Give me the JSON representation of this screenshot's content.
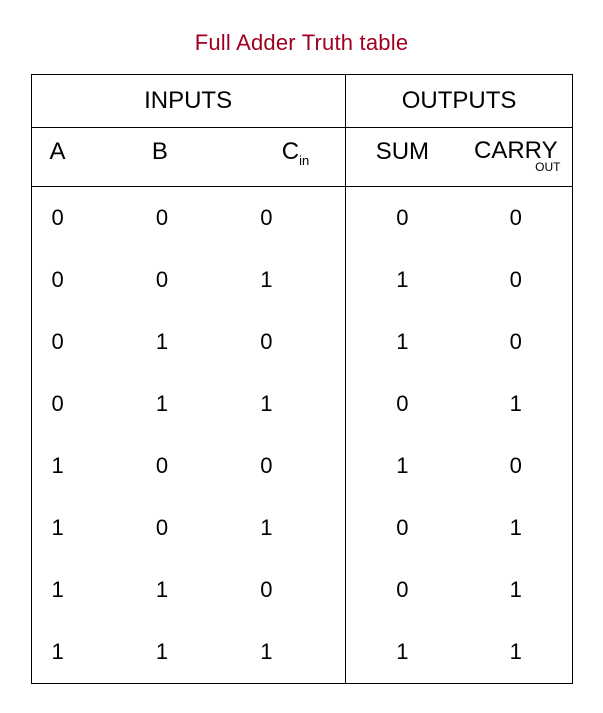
{
  "title": "Full Adder Truth table",
  "group_headers": {
    "inputs": "INPUTS",
    "outputs": "OUTPUTS"
  },
  "columns": {
    "a": "A",
    "b": "B",
    "cin": "C",
    "cin_sub": "in",
    "sum": "SUM",
    "carry": "CARRY",
    "carry_sub": "OUT"
  },
  "rows": [
    {
      "a": "0",
      "b": "0",
      "cin": "0",
      "sum": "0",
      "carry": "0"
    },
    {
      "a": "0",
      "b": "0",
      "cin": "1",
      "sum": "1",
      "carry": "0"
    },
    {
      "a": "0",
      "b": "1",
      "cin": "0",
      "sum": "1",
      "carry": "0"
    },
    {
      "a": "0",
      "b": "1",
      "cin": "1",
      "sum": "0",
      "carry": "1"
    },
    {
      "a": "1",
      "b": "0",
      "cin": "0",
      "sum": "1",
      "carry": "0"
    },
    {
      "a": "1",
      "b": "0",
      "cin": "1",
      "sum": "0",
      "carry": "1"
    },
    {
      "a": "1",
      "b": "1",
      "cin": "0",
      "sum": "0",
      "carry": "1"
    },
    {
      "a": "1",
      "b": "1",
      "cin": "1",
      "sum": "1",
      "carry": "1"
    }
  ],
  "chart_data": {
    "type": "table",
    "title": "Full Adder Truth table",
    "columns": [
      "A",
      "B",
      "Cin",
      "SUM",
      "CARRY_OUT"
    ],
    "data": [
      [
        0,
        0,
        0,
        0,
        0
      ],
      [
        0,
        0,
        1,
        1,
        0
      ],
      [
        0,
        1,
        0,
        1,
        0
      ],
      [
        0,
        1,
        1,
        0,
        1
      ],
      [
        1,
        0,
        0,
        1,
        0
      ],
      [
        1,
        0,
        1,
        0,
        1
      ],
      [
        1,
        1,
        0,
        0,
        1
      ],
      [
        1,
        1,
        1,
        1,
        1
      ]
    ]
  }
}
